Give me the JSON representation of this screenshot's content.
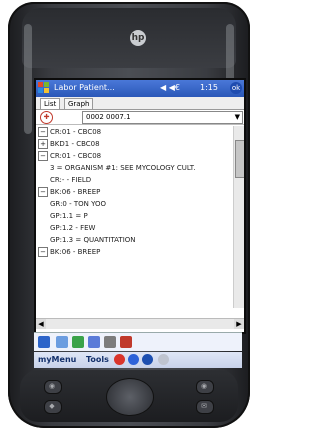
{
  "window": {
    "title": "Labor Patient...",
    "status_icons": "◀ ◀€",
    "time": "1:15",
    "close_label": "ok"
  },
  "tabs": [
    {
      "label": "List"
    },
    {
      "label": "Graph"
    }
  ],
  "patient": {
    "selected": "0002 0007.1"
  },
  "list_items": [
    {
      "label": "CR:01 - CBC08"
    },
    {
      "label": "BKD1 - CBC08"
    },
    {
      "label": "CR:01 - CBC08"
    },
    {
      "label": "3 = ORGANISM #1: SEE MYCOLOGY CULT."
    },
    {
      "label": "CR:- - FIELD"
    },
    {
      "label": "BK:06 - BREEP"
    },
    {
      "label": "GR:0 - TON YOO"
    },
    {
      "label": "GP:1.1 = P"
    },
    {
      "label": "GP:1.2 - FEW"
    },
    {
      "label": "GP:1.3 = QUANTITATION"
    },
    {
      "label": "BK:06 - BREEP"
    }
  ],
  "menu_bar": {
    "my_menu": "myMenu",
    "tools": "Tools"
  },
  "colors": {
    "title_bar": "#2a57b8",
    "accent_red": "#c0392b",
    "menu_text": "#13306b"
  }
}
